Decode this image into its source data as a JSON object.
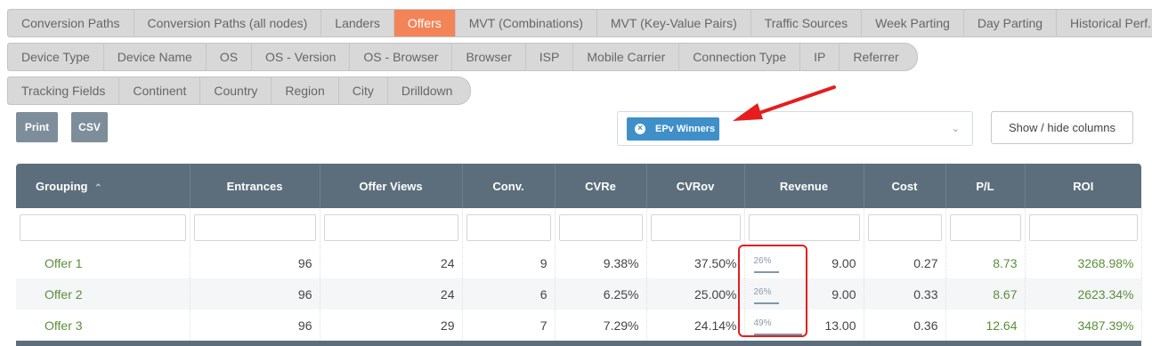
{
  "tabs": {
    "row1": [
      "Conversion Paths",
      "Conversion Paths (all nodes)",
      "Landers",
      "Offers",
      "MVT (Combinations)",
      "MVT (Key-Value Pairs)",
      "Traffic Sources",
      "Week Parting",
      "Day Parting",
      "Historical Perf."
    ],
    "row2": [
      "Device Type",
      "Device Name",
      "OS",
      "OS - Version",
      "OS - Browser",
      "Browser",
      "ISP",
      "Mobile Carrier",
      "Connection Type",
      "IP",
      "Referrer"
    ],
    "row3": [
      "Tracking Fields",
      "Continent",
      "Country",
      "Region",
      "City",
      "Drilldown"
    ],
    "active": "Offers"
  },
  "toolbar": {
    "print_label": "Print",
    "csv_label": "CSV",
    "show_hide_label": "Show / hide columns"
  },
  "filter": {
    "chip_label": "EPv Winners"
  },
  "colors": {
    "accent_tab": "#f28458",
    "header_bg": "#5c6e7c",
    "chip_bg": "#3f8fc9",
    "positive": "#5a8f3a",
    "annotation": "#e51d1d"
  },
  "table": {
    "columns": [
      "Grouping",
      "Entrances",
      "Offer Views",
      "Conv.",
      "CVRe",
      "CVRov",
      "Revenue",
      "Cost",
      "P/L",
      "ROI"
    ],
    "sort_column": "Grouping",
    "sort_icon": "chevron-up-icon",
    "rows": [
      {
        "name": "Offer 1",
        "entrances": "96",
        "offer_views": "24",
        "conv": "9",
        "cvre": "9.38%",
        "cvrov": "37.50%",
        "revenue_share": "26%",
        "revenue": "9.00",
        "cost": "0.27",
        "pl": "8.73",
        "roi": "3268.98%"
      },
      {
        "name": "Offer 2",
        "entrances": "96",
        "offer_views": "24",
        "conv": "6",
        "cvre": "6.25%",
        "cvrov": "25.00%",
        "revenue_share": "26%",
        "revenue": "9.00",
        "cost": "0.33",
        "pl": "8.67",
        "roi": "2623.34%"
      },
      {
        "name": "Offer 3",
        "entrances": "96",
        "offer_views": "29",
        "conv": "7",
        "cvre": "7.29%",
        "cvrov": "24.14%",
        "revenue_share": "49%",
        "revenue": "13.00",
        "cost": "0.36",
        "pl": "12.64",
        "roi": "3487.39%"
      }
    ]
  }
}
